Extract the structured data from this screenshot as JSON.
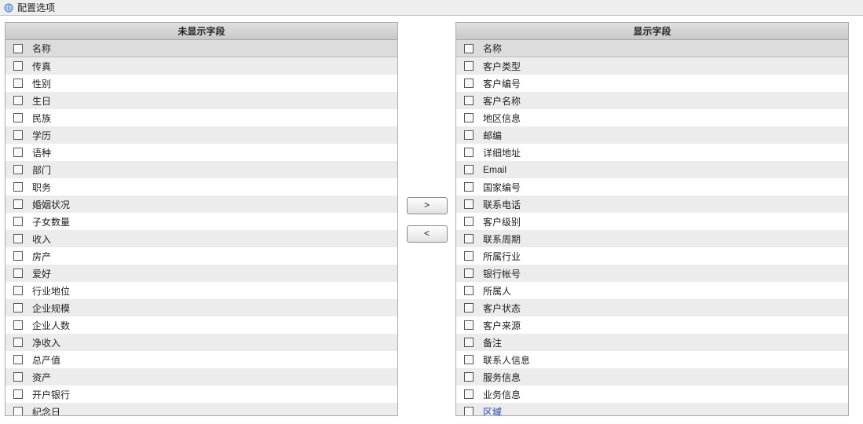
{
  "titlebar": {
    "icon": "globe-icon",
    "title": "配置选项"
  },
  "left": {
    "header": "未显示字段",
    "name_col": "名称",
    "items": [
      "传真",
      "性别",
      "生日",
      "民族",
      "学历",
      "语种",
      "部门",
      "职务",
      "婚姻状况",
      "子女数量",
      "收入",
      "房产",
      "爱好",
      "行业地位",
      "企业规模",
      "企业人数",
      "净收入",
      "总产值",
      "资产",
      "开户银行",
      "纪念日"
    ]
  },
  "right": {
    "header": "显示字段",
    "name_col": "名称",
    "items": [
      {
        "label": "客户类型"
      },
      {
        "label": "客户编号"
      },
      {
        "label": "客户名称"
      },
      {
        "label": "地区信息"
      },
      {
        "label": "邮编"
      },
      {
        "label": "详细地址"
      },
      {
        "label": "Email"
      },
      {
        "label": "国家编号"
      },
      {
        "label": "联系电话"
      },
      {
        "label": "客户级别"
      },
      {
        "label": "联系周期"
      },
      {
        "label": "所属行业"
      },
      {
        "label": "银行帐号"
      },
      {
        "label": "所属人"
      },
      {
        "label": "客户状态"
      },
      {
        "label": "客户来源"
      },
      {
        "label": "备注"
      },
      {
        "label": "联系人信息"
      },
      {
        "label": "服务信息"
      },
      {
        "label": "业务信息"
      },
      {
        "label": "区域",
        "link": true
      }
    ]
  },
  "buttons": {
    "right": ">",
    "left": "<"
  }
}
